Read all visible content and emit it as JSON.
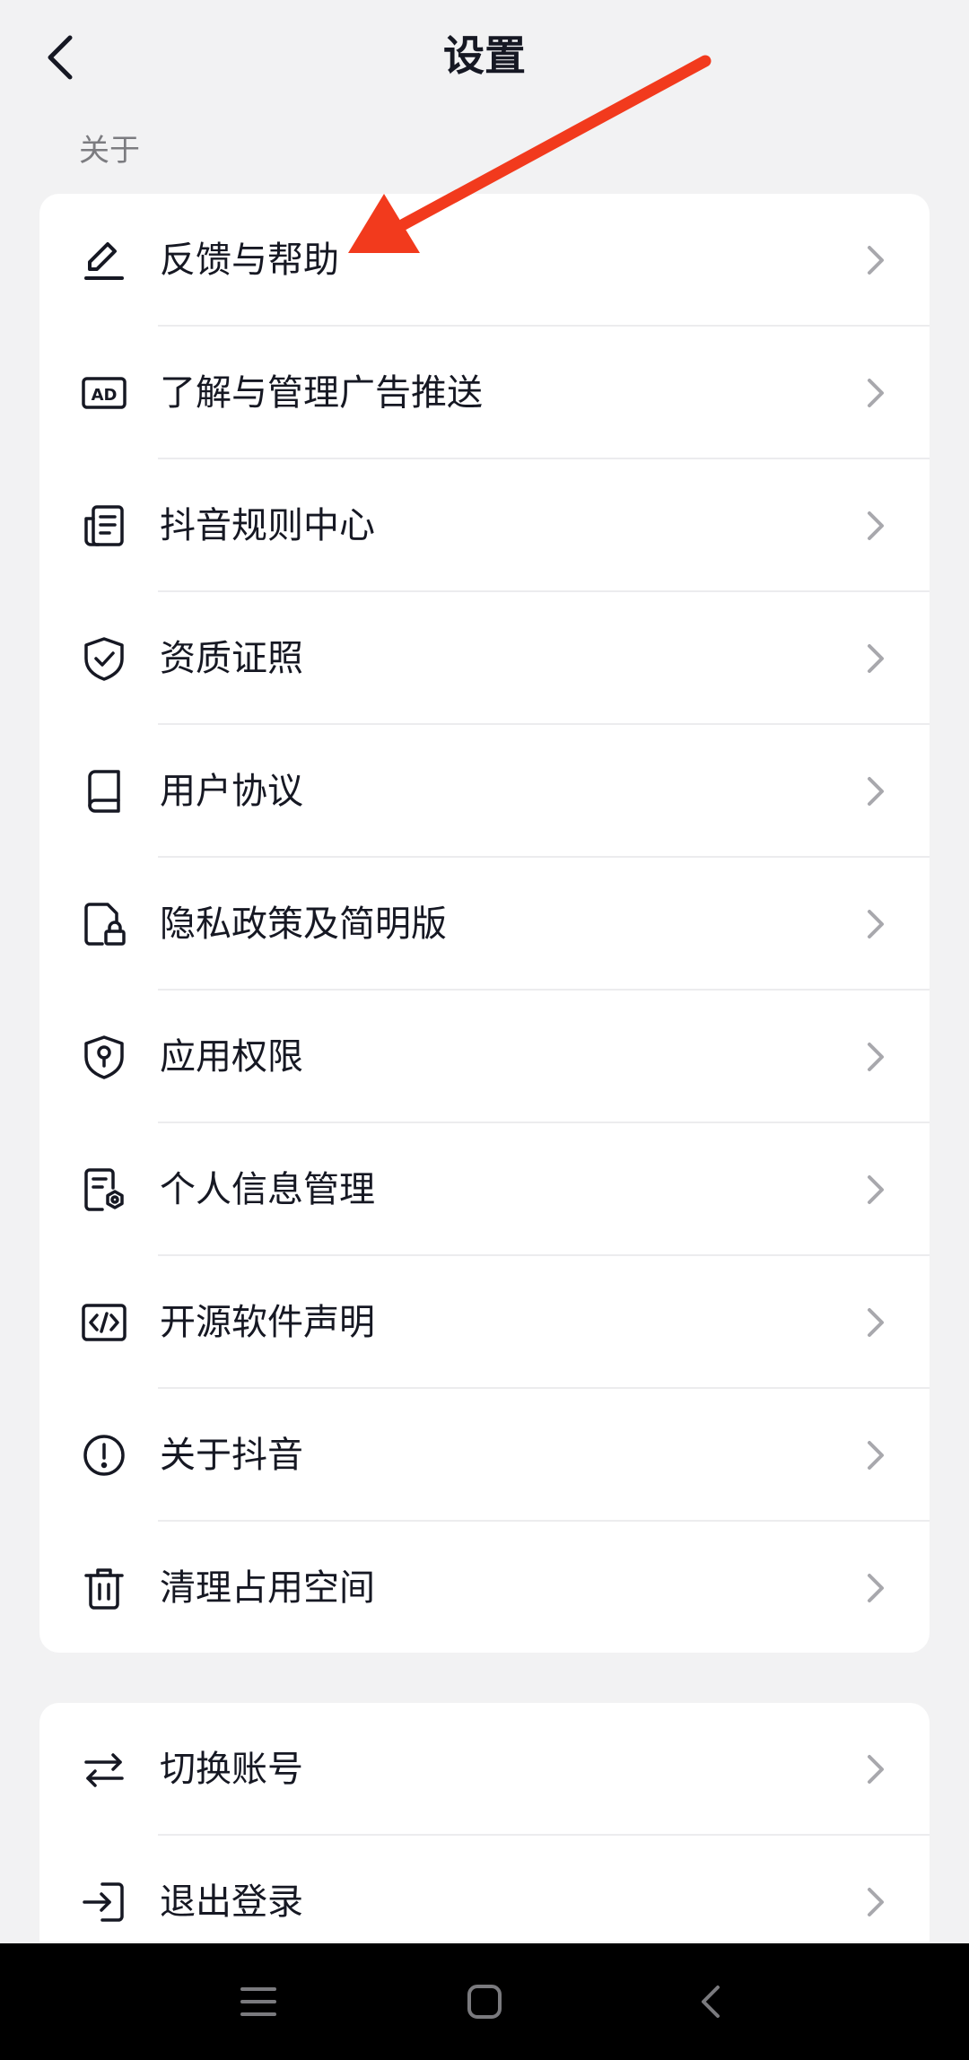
{
  "header": {
    "title": "设置",
    "back_icon": "chevron-left-icon"
  },
  "section": {
    "label": "关于"
  },
  "about_items": [
    {
      "label": "反馈与帮助",
      "icon": "pen-icon"
    },
    {
      "label": "了解与管理广告推送",
      "icon": "ad-icon"
    },
    {
      "label": "抖音规则中心",
      "icon": "document-list-icon"
    },
    {
      "label": "资质证照",
      "icon": "shield-check-icon"
    },
    {
      "label": "用户协议",
      "icon": "book-icon"
    },
    {
      "label": "隐私政策及简明版",
      "icon": "document-lock-icon"
    },
    {
      "label": "应用权限",
      "icon": "shield-key-icon"
    },
    {
      "label": "个人信息管理",
      "icon": "document-gear-icon"
    },
    {
      "label": "开源软件声明",
      "icon": "code-icon"
    },
    {
      "label": "关于抖音",
      "icon": "info-circle-icon"
    },
    {
      "label": "清理占用空间",
      "icon": "trash-icon"
    }
  ],
  "account_items": [
    {
      "label": "切换账号",
      "icon": "swap-icon"
    },
    {
      "label": "退出登录",
      "icon": "logout-icon"
    }
  ],
  "annotation": {
    "arrow_color": "#f23a1d"
  },
  "navbar": {
    "menu_icon": "menu-icon",
    "home_icon": "home-square-icon",
    "back_icon": "back-triangle-icon"
  },
  "colors": {
    "background": "#f2f2f3",
    "card": "#ffffff",
    "text": "#161823",
    "secondary_text": "#7c7c80",
    "chevron": "#a8a8ad",
    "navbar": "#000000"
  }
}
